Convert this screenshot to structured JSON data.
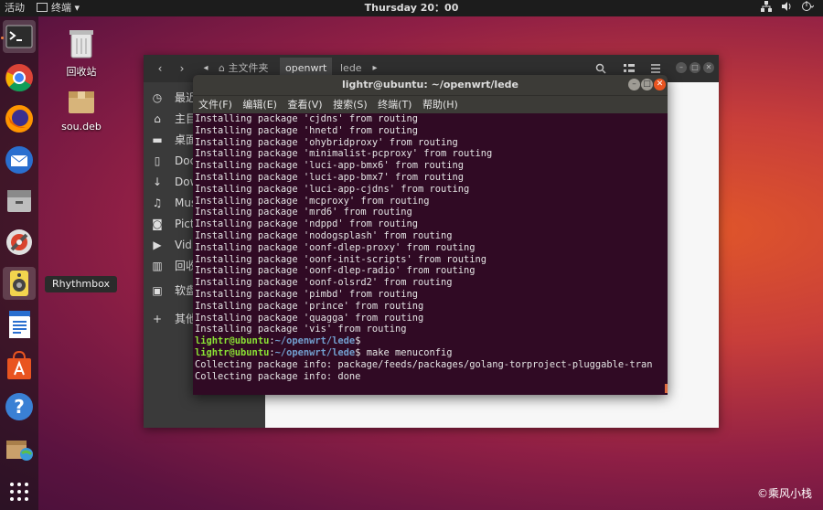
{
  "topbar": {
    "activities": "活动",
    "app_menu": "终端 ▾",
    "clock": "Thursday 20：00",
    "tray_icons": [
      "network-icon",
      "volume-icon",
      "power-icon"
    ]
  },
  "dock": {
    "items": [
      "terminal",
      "chrome",
      "firefox",
      "thunderbird",
      "files",
      "settings",
      "rhythmbox",
      "libreoffice-writer",
      "software-center",
      "help",
      "archive-manager",
      "show-apps"
    ],
    "tooltip": "Rhythmbox"
  },
  "desktop": {
    "icons": [
      {
        "label": "回收站",
        "icon": "trash-icon"
      },
      {
        "label": "sou.deb",
        "icon": "package-icon"
      }
    ]
  },
  "files_window": {
    "tabs": [
      "主文件夹",
      "openwrt",
      "lede"
    ],
    "sidebar": [
      "最近",
      "主目",
      "桌面",
      "Doc",
      "Dow",
      "Mus",
      "Pict",
      "Vid",
      "回收",
      "软盘",
      "其他"
    ]
  },
  "terminal": {
    "title": "lightr@ubuntu: ~/openwrt/lede",
    "menu": [
      "文件(F)",
      "编辑(E)",
      "查看(V)",
      "搜索(S)",
      "终端(T)",
      "帮助(H)"
    ],
    "lines": [
      "Installing package 'cjdns' from routing",
      "Installing package 'hnetd' from routing",
      "Installing package 'ohybridproxy' from routing",
      "Installing package 'minimalist-pcproxy' from routing",
      "Installing package 'luci-app-bmx6' from routing",
      "Installing package 'luci-app-bmx7' from routing",
      "Installing package 'luci-app-cjdns' from routing",
      "Installing package 'mcproxy' from routing",
      "Installing package 'mrd6' from routing",
      "Installing package 'ndppd' from routing",
      "Installing package 'nodogsplash' from routing",
      "Installing package 'oonf-dlep-proxy' from routing",
      "Installing package 'oonf-init-scripts' from routing",
      "Installing package 'oonf-dlep-radio' from routing",
      "Installing package 'oonf-olsrd2' from routing",
      "Installing package 'pimbd' from routing",
      "Installing package 'prince' from routing",
      "Installing package 'quagga' from routing",
      "Installing package 'vis' from routing"
    ],
    "prompt_user": "lightr@ubuntu",
    "prompt_sep": ":",
    "prompt_path": "~/openwrt/lede",
    "prompt_end": "$",
    "prompt1_cmd": "",
    "prompt2_cmd": " make menuconfig",
    "out1": "Collecting package info: package/feeds/packages/golang-torproject-pluggable-tran",
    "out2": "Collecting package info: done"
  },
  "watermark": "©乘风小栈",
  "colors": {
    "terminal_bg": "#300a24",
    "prompt_user": "#8ae234",
    "prompt_path": "#729fcf",
    "accent": "#e95420"
  }
}
